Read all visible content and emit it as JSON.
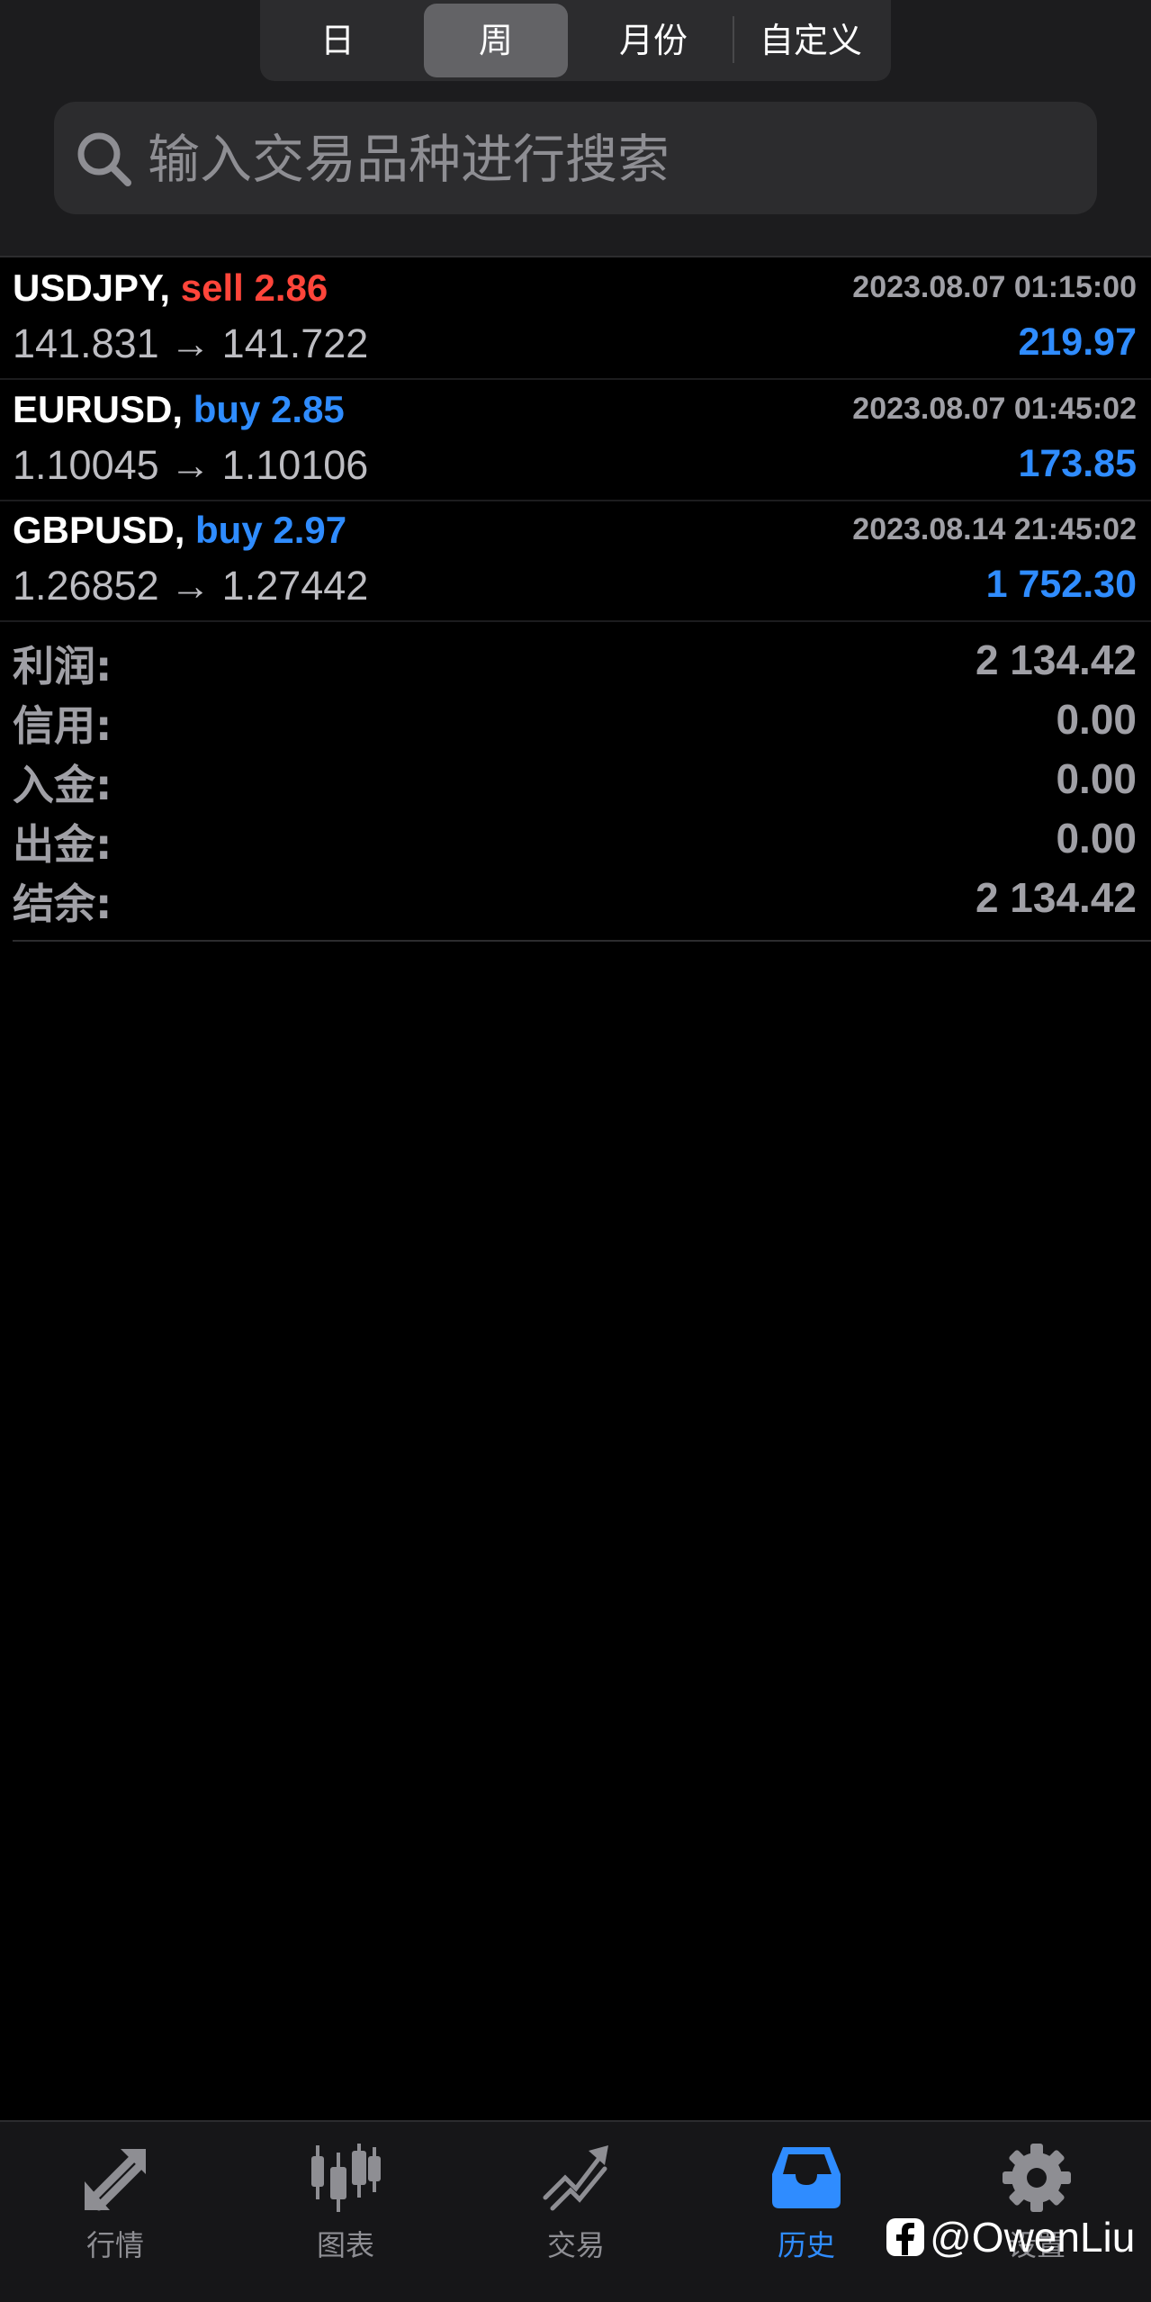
{
  "period_tabs": [
    "日",
    "周",
    "月份",
    "自定义"
  ],
  "active_period": "周",
  "search": {
    "placeholder": "输入交易品种进行搜索"
  },
  "trades": [
    {
      "symbol": "USDJPY,",
      "side": "sell",
      "volume": "2.86",
      "side_label": "sell 2.86",
      "time": "2023.08.07 01:15:00",
      "prices": "141.831 → 141.722",
      "profit": "219.97"
    },
    {
      "symbol": "EURUSD,",
      "side": "buy",
      "volume": "2.85",
      "side_label": "buy 2.85",
      "time": "2023.08.07 01:45:02",
      "prices": "1.10045 → 1.10106",
      "profit": "173.85"
    },
    {
      "symbol": "GBPUSD,",
      "side": "buy",
      "volume": "2.97",
      "side_label": "buy 2.97",
      "time": "2023.08.14 21:45:02",
      "prices": "1.26852 → 1.27442",
      "profit": "1 752.30"
    }
  ],
  "summary": [
    {
      "label": "利润:",
      "value": "2 134.42"
    },
    {
      "label": "信用:",
      "value": "0.00"
    },
    {
      "label": "入金:",
      "value": "0.00"
    },
    {
      "label": "出金:",
      "value": "0.00"
    },
    {
      "label": "结余:",
      "value": "2 134.42"
    }
  ],
  "tab_bar": {
    "items": [
      {
        "label": "行情",
        "icon": "quotes-arrows-icon"
      },
      {
        "label": "图表",
        "icon": "candlestick-chart-icon"
      },
      {
        "label": "交易",
        "icon": "trade-trend-icon"
      },
      {
        "label": "历史",
        "icon": "history-inbox-icon"
      },
      {
        "label": "设置",
        "icon": "gear-icon"
      }
    ],
    "active": "历史"
  },
  "watermark": {
    "text": "@OwenLiu",
    "icon": "facebook-icon"
  },
  "colors": {
    "sell": "#ff453a",
    "buy": "#2f8cff",
    "profit": "#2f8cff",
    "active_tab": "#2f8cff"
  }
}
